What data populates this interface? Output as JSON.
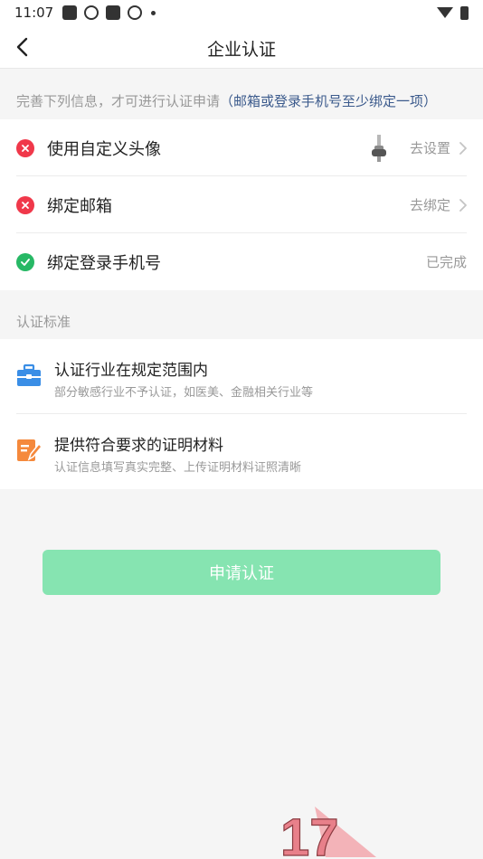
{
  "status_bar": {
    "time": "11:07"
  },
  "nav": {
    "title": "企业认证"
  },
  "hint": {
    "prefix": "完善下列信息，才可进行认证申请",
    "highlight": "（邮箱或登录手机号至少绑定一项）"
  },
  "requirements": [
    {
      "label": "使用自定义头像",
      "action": "去设置",
      "state": "incomplete"
    },
    {
      "label": "绑定邮箱",
      "action": "去绑定",
      "state": "incomplete"
    },
    {
      "label": "绑定登录手机号",
      "action": "已完成",
      "state": "complete"
    }
  ],
  "standards": {
    "title": "认证标准",
    "items": [
      {
        "title": "认证行业在规定范围内",
        "desc": "部分敏感行业不予认证，如医美、金融相关行业等",
        "icon": "briefcase-icon"
      },
      {
        "title": "提供符合要求的证明材料",
        "desc": "认证信息填写真实完整、上传证明材料证照清晰",
        "icon": "document-edit-icon"
      }
    ]
  },
  "apply_button": {
    "label": "申请认证",
    "state": "disabled"
  },
  "watermark": {
    "text": "17"
  },
  "colors": {
    "error": "#f0384a",
    "success": "#27b865",
    "accent_link": "#3b5a8c",
    "button_disabled": "#86e4b1",
    "briefcase": "#3a8ee6",
    "document": "#f5893c"
  }
}
